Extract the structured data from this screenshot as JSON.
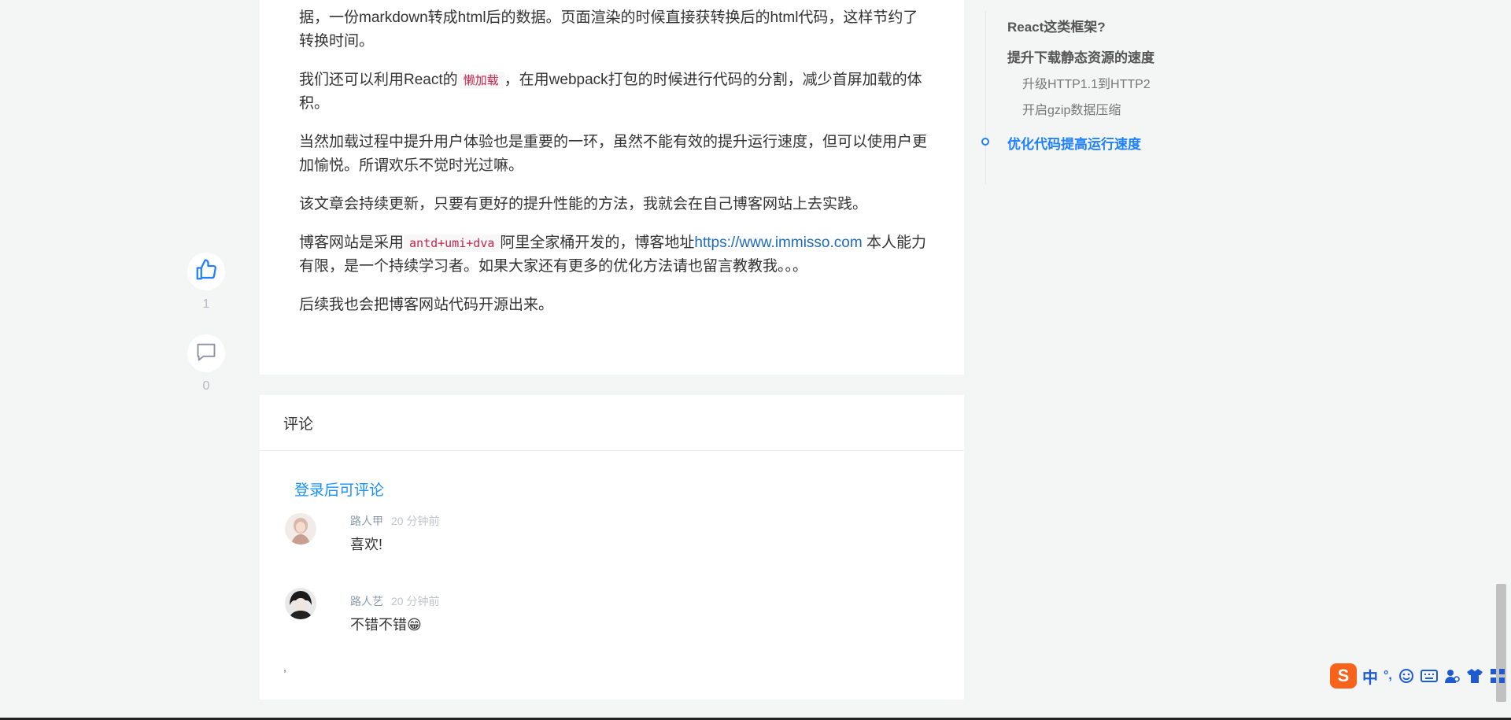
{
  "article": {
    "paragraphs": [
      [
        "据，一份markdown转成html后的数据。页面渲染的时候直接获转换后的html代码，这样节约了转换时间。"
      ],
      [
        "我们还可以利用React的",
        {
          "code": "懒加载"
        },
        "，在用webpack打包的时候进行代码的分割，减少首屏加载的体积。"
      ],
      [
        "当然加载过程中提升用户体验也是重要的一环，虽然不能有效的提升运行速度，但可以使用户更加愉悦。所谓欢乐不觉时光过嘛。"
      ],
      [
        "该文章会持续更新，只要有更好的提升性能的方法，我就会在自己博客网站上去实践。"
      ],
      [
        "博客网站是采用",
        {
          "code": "antd+umi+dva"
        },
        "阿里全家桶开发的，博客地址",
        {
          "link": "https://www.immisso.com"
        },
        " 本人能力有限，是一个持续学习者。如果大家还有更多的优化方法请也留言教教我。。。"
      ],
      [
        "后续我也会把博客网站代码开源出来。"
      ]
    ]
  },
  "actions": {
    "like_icon": "thumbs-up-icon",
    "like_count": "1",
    "comment_icon": "comment-icon",
    "comment_count": "0"
  },
  "comments": {
    "title": "评论",
    "login_prompt": "登录后可评论",
    "items": [
      {
        "author": "路人甲",
        "time": "20 分钟前",
        "text": "喜欢!"
      },
      {
        "author": "路人艺",
        "time": "20 分钟前",
        "text": "不错不错",
        "emoji": "😁"
      }
    ],
    "stray_mark": ","
  },
  "toc": {
    "items": [
      {
        "label": "React这类框架?",
        "level": 1
      },
      {
        "label": "提升下载静态资源的速度",
        "level": 1
      },
      {
        "label": "升级HTTP1.1到HTTP2",
        "level": 2
      },
      {
        "label": "开启gzip数据压缩",
        "level": 2
      },
      {
        "label": "优化代码提高运行速度",
        "level": 1,
        "active": true
      }
    ]
  },
  "ime": {
    "logo": "S",
    "mode": "中",
    "punct": "°,"
  },
  "colors": {
    "accent": "#1e80ff",
    "login_link": "#1890ff",
    "code_text": "#c7254e",
    "page_bg": "#f4f5f5"
  }
}
